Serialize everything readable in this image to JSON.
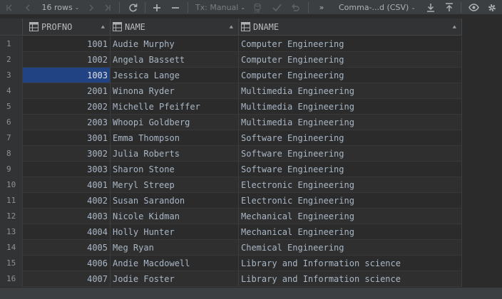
{
  "toolbar": {
    "rows_label": "16 rows",
    "tx_label": "Tx: Manual",
    "export_label": "Comma-...d (CSV)"
  },
  "columns": [
    {
      "name": "PROFNO"
    },
    {
      "name": "NAME"
    },
    {
      "name": "DNAME"
    }
  ],
  "rows": [
    {
      "num": "1",
      "profno": "1001",
      "name": "Audie Murphy",
      "dname": "Computer Engineering"
    },
    {
      "num": "2",
      "profno": "1002",
      "name": "Angela Bassett",
      "dname": "Computer Engineering"
    },
    {
      "num": "3",
      "profno": "1003",
      "name": "Jessica Lange",
      "dname": "Computer Engineering"
    },
    {
      "num": "4",
      "profno": "2001",
      "name": "Winona Ryder",
      "dname": "Multimedia Engineering"
    },
    {
      "num": "5",
      "profno": "2002",
      "name": "Michelle Pfeiffer",
      "dname": "Multimedia Engineering"
    },
    {
      "num": "6",
      "profno": "2003",
      "name": "Whoopi Goldberg",
      "dname": "Multimedia Engineering"
    },
    {
      "num": "7",
      "profno": "3001",
      "name": "Emma Thompson",
      "dname": "Software Engineering"
    },
    {
      "num": "8",
      "profno": "3002",
      "name": "Julia Roberts",
      "dname": "Software Engineering"
    },
    {
      "num": "9",
      "profno": "3003",
      "name": "Sharon Stone",
      "dname": "Software Engineering"
    },
    {
      "num": "10",
      "profno": "4001",
      "name": "Meryl Streep",
      "dname": "Electronic Engineering"
    },
    {
      "num": "11",
      "profno": "4002",
      "name": "Susan Sarandon",
      "dname": "Electronic Engineering"
    },
    {
      "num": "12",
      "profno": "4003",
      "name": "Nicole Kidman",
      "dname": "Mechanical Engineering"
    },
    {
      "num": "13",
      "profno": "4004",
      "name": "Holly Hunter",
      "dname": "Mechanical Engineering"
    },
    {
      "num": "14",
      "profno": "4005",
      "name": "Meg Ryan",
      "dname": "Chemical Engineering"
    },
    {
      "num": "15",
      "profno": "4006",
      "name": "Andie Macdowell",
      "dname": "Library and Information science"
    },
    {
      "num": "16",
      "profno": "4007",
      "name": "Jodie Foster",
      "dname": "Library and Information science"
    }
  ],
  "selected_row": 2,
  "colors": {
    "background": "#2b2b2b",
    "toolbar": "#3c3f41",
    "selection": "#214283",
    "text": "#a9b7c6"
  }
}
